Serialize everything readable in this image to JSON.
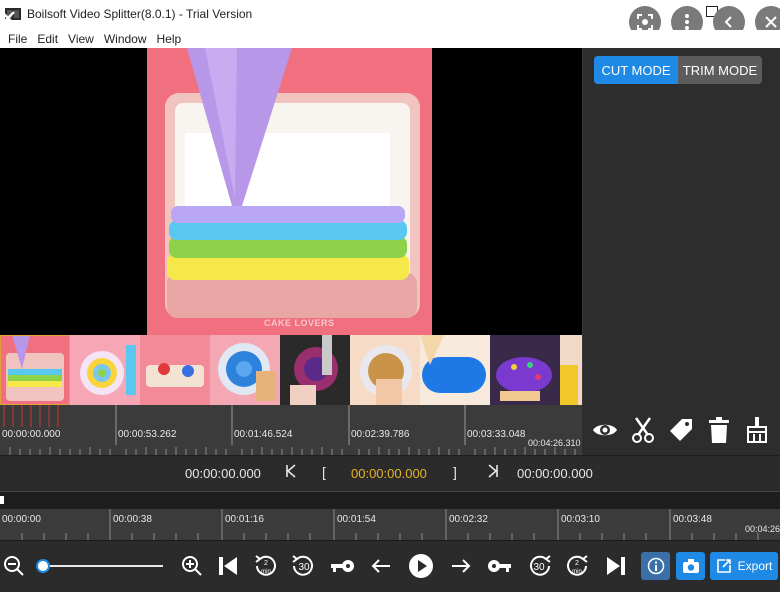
{
  "window": {
    "title": "Boilsoft Video Splitter(8.0.1) - Trial Version"
  },
  "menu": [
    "File",
    "Edit",
    "View",
    "Window",
    "Help"
  ],
  "video": {
    "watermark": "CAKE LOVERS"
  },
  "modes": {
    "cut_label": "CUT MODE",
    "trim_label": "TRIM MODE",
    "active": "cut"
  },
  "ruler_top": {
    "labels": [
      "00:00:00.000",
      "00:00:53.262",
      "00:01:46.524",
      "00:02:39.786",
      "00:03:33.048"
    ],
    "end_label": "00:04:26.310"
  },
  "time_row": {
    "start": "00:00:00.000",
    "prev_key": "K",
    "open_bracket": "[",
    "current": "00:00:00.000",
    "close_bracket": "]",
    "next_key": "K",
    "end": "00:00:00.000"
  },
  "ruler_bottom": {
    "labels": [
      "00:00:00",
      "00:00:38",
      "00:01:16",
      "00:01:54",
      "00:02:32",
      "00:03:10",
      "00:03:48"
    ],
    "end_label": "00:04:26"
  },
  "toolbar": {
    "export_label": "Export",
    "rewind_badge": "2 min",
    "skip_back_badge": "30",
    "skip_fwd_badge": "30",
    "forward_badge": "2 min",
    "zoom_level": 0
  },
  "colors": {
    "accent": "#1e8ae6",
    "current_time": "#e6b422"
  }
}
